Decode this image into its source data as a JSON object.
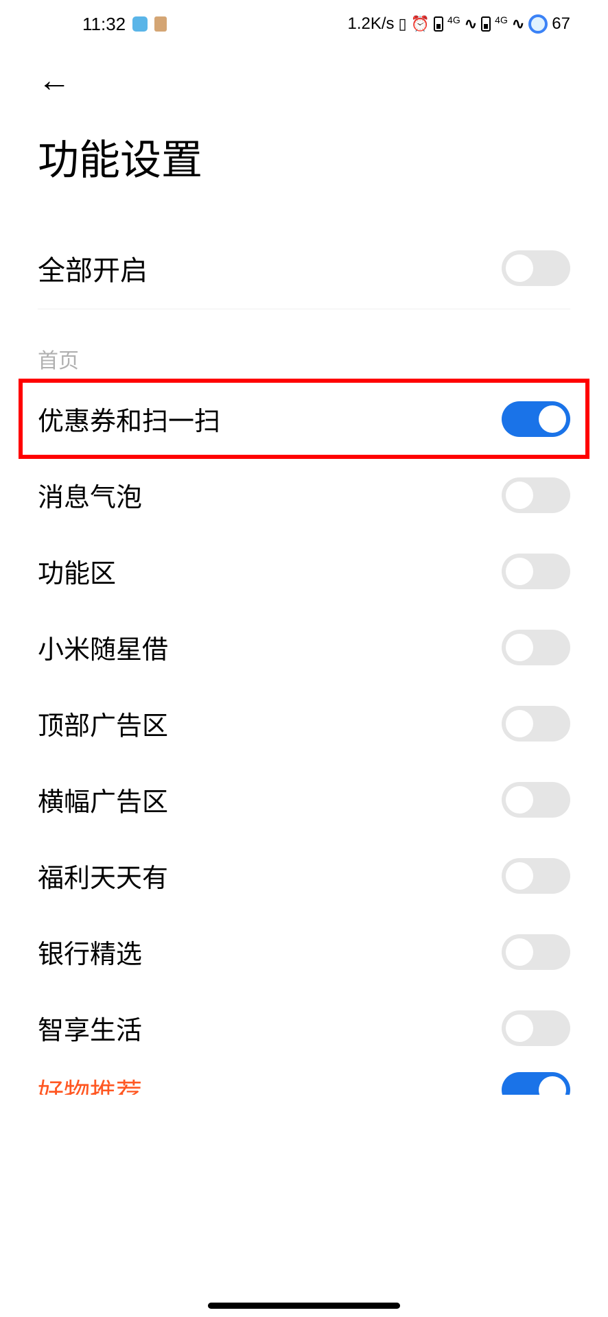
{
  "status": {
    "time": "11:32",
    "speed": "1.2K/s",
    "net_label": "4G",
    "battery": "67"
  },
  "page": {
    "title": "功能设置"
  },
  "master": {
    "label": "全部开启",
    "on": false
  },
  "section": {
    "header": "首页"
  },
  "settings": [
    {
      "label": "优惠券和扫一扫",
      "on": true,
      "highlighted": true
    },
    {
      "label": "消息气泡",
      "on": false,
      "highlighted": false
    },
    {
      "label": "功能区",
      "on": false,
      "highlighted": false
    },
    {
      "label": "小米随星借",
      "on": false,
      "highlighted": false
    },
    {
      "label": "顶部广告区",
      "on": false,
      "highlighted": false
    },
    {
      "label": "横幅广告区",
      "on": false,
      "highlighted": false
    },
    {
      "label": "福利天天有",
      "on": false,
      "highlighted": false
    },
    {
      "label": "银行精选",
      "on": false,
      "highlighted": false
    },
    {
      "label": "智享生活",
      "on": false,
      "highlighted": false
    }
  ],
  "partial": {
    "label": "好物推荐",
    "on": true
  }
}
